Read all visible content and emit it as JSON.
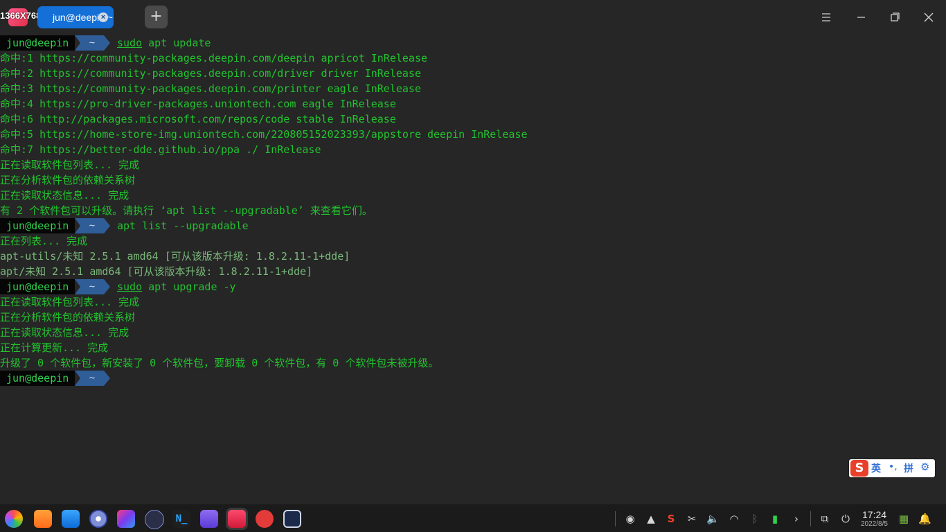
{
  "window": {
    "resolution_badge": "1366X768",
    "tab_title": "jun@deepin:~",
    "tab_close": "×",
    "new_tab": "+"
  },
  "prompt": {
    "user": "jun@deepin",
    "cwd": "~"
  },
  "terminal": {
    "cmd1_sudo": "sudo",
    "cmd1_rest": " apt update",
    "update_lines": [
      "命中:1 https://community-packages.deepin.com/deepin apricot InRelease",
      "命中:2 https://community-packages.deepin.com/driver driver InRelease",
      "命中:3 https://community-packages.deepin.com/printer eagle InRelease",
      "命中:4 https://pro-driver-packages.uniontech.com eagle InRelease",
      "命中:6 http://packages.microsoft.com/repos/code stable InRelease",
      "命中:5 https://home-store-img.uniontech.com/220805152023393/appstore deepin InRelease",
      "命中:7 https://better-dde.github.io/ppa ./ InRelease",
      "正在读取软件包列表... 完成",
      "正在分析软件包的依赖关系树",
      "正在读取状态信息... 完成",
      "有 2 个软件包可以升级。请执行 ‘apt list --upgradable’ 来查看它们。"
    ],
    "cmd2": "apt list --upgradable",
    "list_lines": [
      "正在列表... 完成",
      "apt-utils/未知 2.5.1 amd64 [可从该版本升级: 1.8.2.11-1+dde]",
      "apt/未知 2.5.1 amd64 [可从该版本升级: 1.8.2.11-1+dde]"
    ],
    "cmd3_sudo": "sudo",
    "cmd3_rest": " apt upgrade -y",
    "upgrade_lines": [
      "正在读取软件包列表... 完成",
      "正在分析软件包的依赖关系树",
      "正在读取状态信息... 完成",
      "正在计算更新... 完成",
      "升级了 0 个软件包，新安装了 0 个软件包，要卸载 0 个软件包，有 0 个软件包未被升级。"
    ]
  },
  "ime": {
    "logo": "S",
    "lang": "英",
    "punct": "•,",
    "mode": "拼",
    "settings": "⚙"
  },
  "dock": {
    "time": "17:24",
    "date": "2022/8/5",
    "apps": [
      "launcher-icon",
      "file-manager-icon",
      "app-store-icon",
      "settings-icon",
      "intellij-icon",
      "ssh-client-icon",
      "notion-icon",
      "music-icon",
      "terminal-icon",
      "netease-music-icon",
      "editor-icon"
    ]
  }
}
